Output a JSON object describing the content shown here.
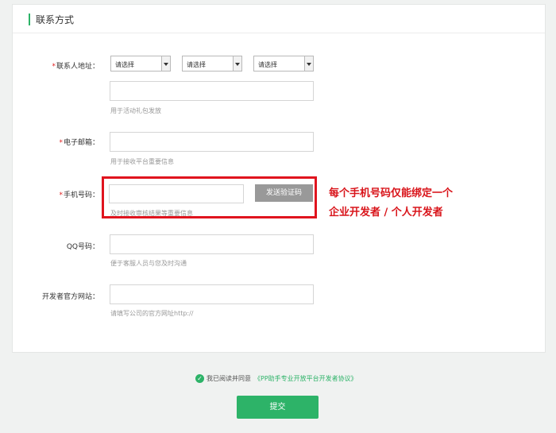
{
  "section_title": "联系方式",
  "address": {
    "label": "联系人地址：",
    "province": "请选择",
    "city": "请选择",
    "district": "请选择",
    "detail_value": "",
    "hint": "用于活动礼包发放"
  },
  "email": {
    "label": "电子邮箱：",
    "value": "",
    "hint": "用于接收平台重要信息"
  },
  "phone": {
    "label": "手机号码：",
    "value": "",
    "send_code_label": "发送验证码",
    "hint": "及时接收审核结果等重要信息"
  },
  "annotation": {
    "line1": "每个手机号码仅能绑定一个",
    "line2": "企业开发者 / 个人开发者"
  },
  "qq": {
    "label": "QQ号码：",
    "value": "",
    "hint": "便于客服人员与您及时沟通"
  },
  "website": {
    "label": "开发者官方网站：",
    "value": "",
    "hint": "请填写公司的官方网址http://"
  },
  "agreement": {
    "text": "我已阅读并同意",
    "link": "《PP助手专业开放平台开发者协议》"
  },
  "submit_label": "提交",
  "required_mark": "*",
  "colors": {
    "accent": "#2db368",
    "alert": "#e0141e"
  }
}
